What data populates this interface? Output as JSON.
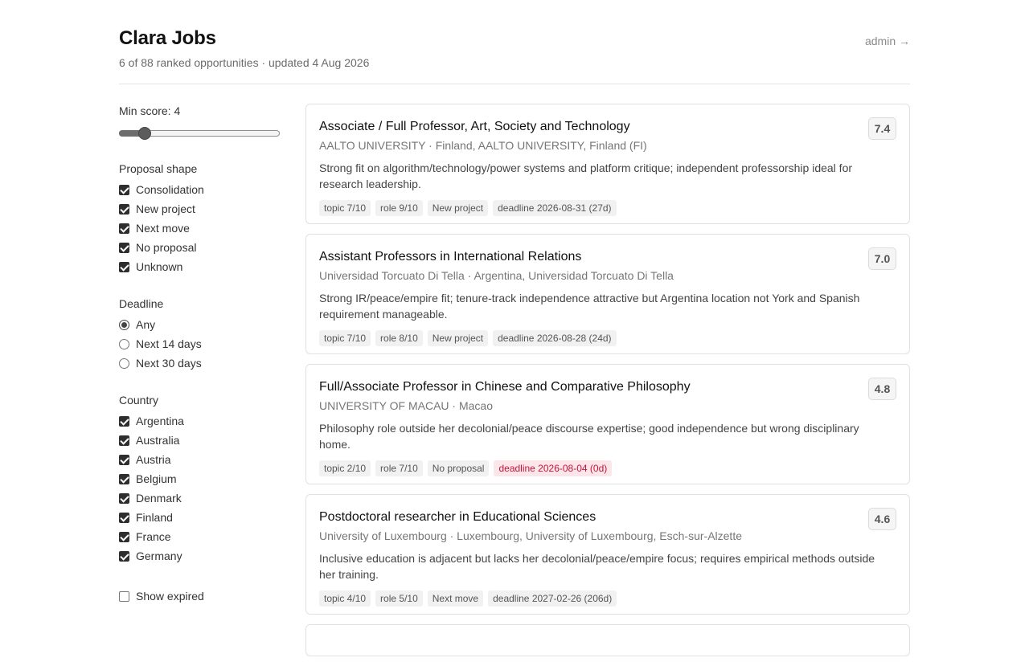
{
  "header": {
    "title": "Clara Jobs",
    "subtitle": "6 of 88 ranked opportunities · updated 4 Aug 2026",
    "admin_link": "admin →"
  },
  "filters": {
    "min_score_label": "Min score: 4",
    "min_score_fraction": 0.13,
    "proposal_shape": {
      "title": "Proposal shape",
      "options": [
        {
          "label": "Consolidation",
          "checked": true
        },
        {
          "label": "New project",
          "checked": true
        },
        {
          "label": "Next move",
          "checked": true
        },
        {
          "label": "No proposal",
          "checked": true
        },
        {
          "label": "Unknown",
          "checked": true
        }
      ]
    },
    "deadline": {
      "title": "Deadline",
      "options": [
        {
          "label": "Any",
          "selected": true
        },
        {
          "label": "Next 14 days",
          "selected": false
        },
        {
          "label": "Next 30 days",
          "selected": false
        }
      ]
    },
    "country": {
      "title": "Country",
      "options": [
        {
          "label": "Argentina",
          "checked": true
        },
        {
          "label": "Australia",
          "checked": true
        },
        {
          "label": "Austria",
          "checked": true
        },
        {
          "label": "Belgium",
          "checked": true
        },
        {
          "label": "Denmark",
          "checked": true
        },
        {
          "label": "Finland",
          "checked": true
        },
        {
          "label": "France",
          "checked": true
        },
        {
          "label": "Germany",
          "checked": true
        }
      ]
    },
    "show_expired": {
      "label": "Show expired",
      "checked": false
    }
  },
  "jobs": [
    {
      "title": "Associate / Full Professor, Art, Society and Technology",
      "org": "AALTO UNIVERSITY · Finland, AALTO UNIVERSITY, Finland (FI)",
      "description": "Strong fit on algorithm/technology/power systems and platform critique; independent professorship ideal for research leadership.",
      "score": "7.4",
      "tags": [
        {
          "text": "topic 7/10",
          "urgent": false
        },
        {
          "text": "role 9/10",
          "urgent": false
        },
        {
          "text": "New project",
          "urgent": false
        },
        {
          "text": "deadline 2026-08-31 (27d)",
          "urgent": false
        }
      ]
    },
    {
      "title": "Assistant Professors in International Relations",
      "org": "Universidad Torcuato Di Tella · Argentina, Universidad Torcuato Di Tella",
      "description": "Strong IR/peace/empire fit; tenure-track independence attractive but Argentina location not York and Spanish requirement manageable.",
      "score": "7.0",
      "tags": [
        {
          "text": "topic 7/10",
          "urgent": false
        },
        {
          "text": "role 8/10",
          "urgent": false
        },
        {
          "text": "New project",
          "urgent": false
        },
        {
          "text": "deadline 2026-08-28 (24d)",
          "urgent": false
        }
      ]
    },
    {
      "title": "Full/Associate Professor in Chinese and Comparative Philosophy",
      "org": "UNIVERSITY OF MACAU · Macao",
      "description": "Philosophy role outside her decolonial/peace discourse expertise; good independence but wrong disciplinary home.",
      "score": "4.8",
      "tags": [
        {
          "text": "topic 2/10",
          "urgent": false
        },
        {
          "text": "role 7/10",
          "urgent": false
        },
        {
          "text": "No proposal",
          "urgent": false
        },
        {
          "text": "deadline 2026-08-04 (0d)",
          "urgent": true
        }
      ]
    },
    {
      "title": "Postdoctoral researcher in Educational Sciences",
      "org": "University of Luxembourg · Luxembourg, University of Luxembourg, Esch-sur-Alzette",
      "description": "Inclusive education is adjacent but lacks her decolonial/peace/empire focus; requires empirical methods outside her training.",
      "score": "4.6",
      "tags": [
        {
          "text": "topic 4/10",
          "urgent": false
        },
        {
          "text": "role 5/10",
          "urgent": false
        },
        {
          "text": "Next move",
          "urgent": false
        },
        {
          "text": "deadline 2027-02-26 (206d)",
          "urgent": false
        }
      ]
    },
    {
      "title": "",
      "org": "",
      "description": "",
      "score": "",
      "tags": []
    }
  ]
}
